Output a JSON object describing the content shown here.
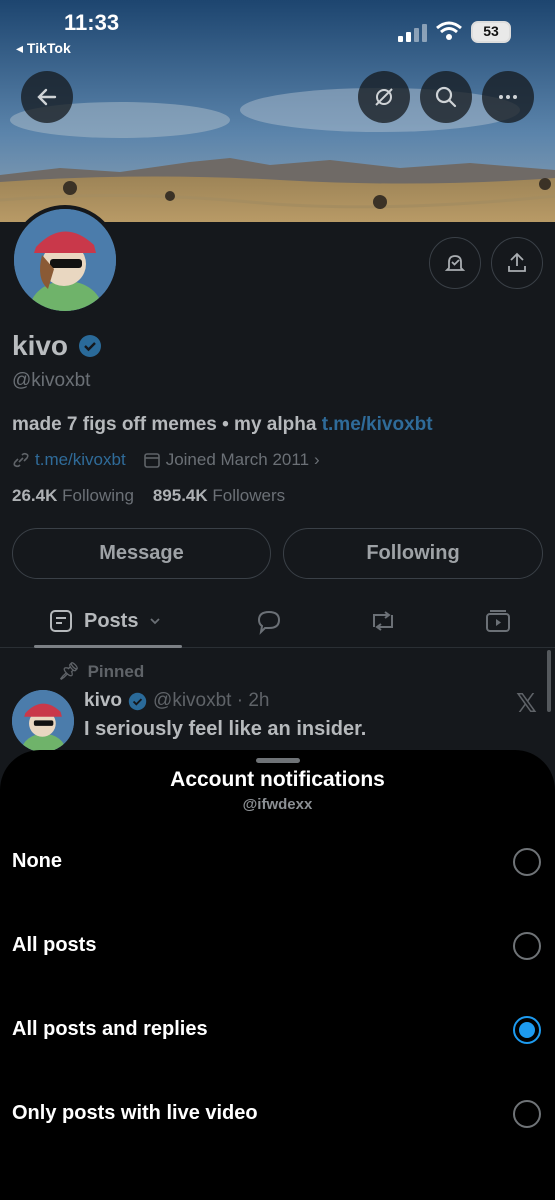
{
  "status_bar": {
    "time": "11:33",
    "back_app": "TikTok",
    "battery": "53"
  },
  "profile": {
    "name": "kivo",
    "handle": "@kivoxbt",
    "bio_text": "made 7 figs off memes • my alpha ",
    "bio_link": "t.me/kivoxbt",
    "website": "t.me/kivoxbt",
    "joined": "Joined March 2011",
    "following_count": "26.4K",
    "following_label": "Following",
    "followers_count": "895.4K",
    "followers_label": "Followers",
    "message_button": "Message",
    "following_button": "Following"
  },
  "tabs": {
    "posts_label": "Posts"
  },
  "post": {
    "pinned_label": "Pinned",
    "author": "kivo",
    "handle_time": "@kivoxbt · 2h",
    "text": "I seriously feel like an insider."
  },
  "sheet": {
    "title": "Account notifications",
    "subtitle": "@ifwdexx",
    "options": [
      {
        "label": "None",
        "selected": false
      },
      {
        "label": "All posts",
        "selected": false
      },
      {
        "label": "All posts and replies",
        "selected": true
      },
      {
        "label": "Only posts with live video",
        "selected": false
      }
    ]
  },
  "colors": {
    "accent": "#1d9bf0",
    "sheet_bg": "#000000",
    "profile_bg": "#15181c"
  }
}
